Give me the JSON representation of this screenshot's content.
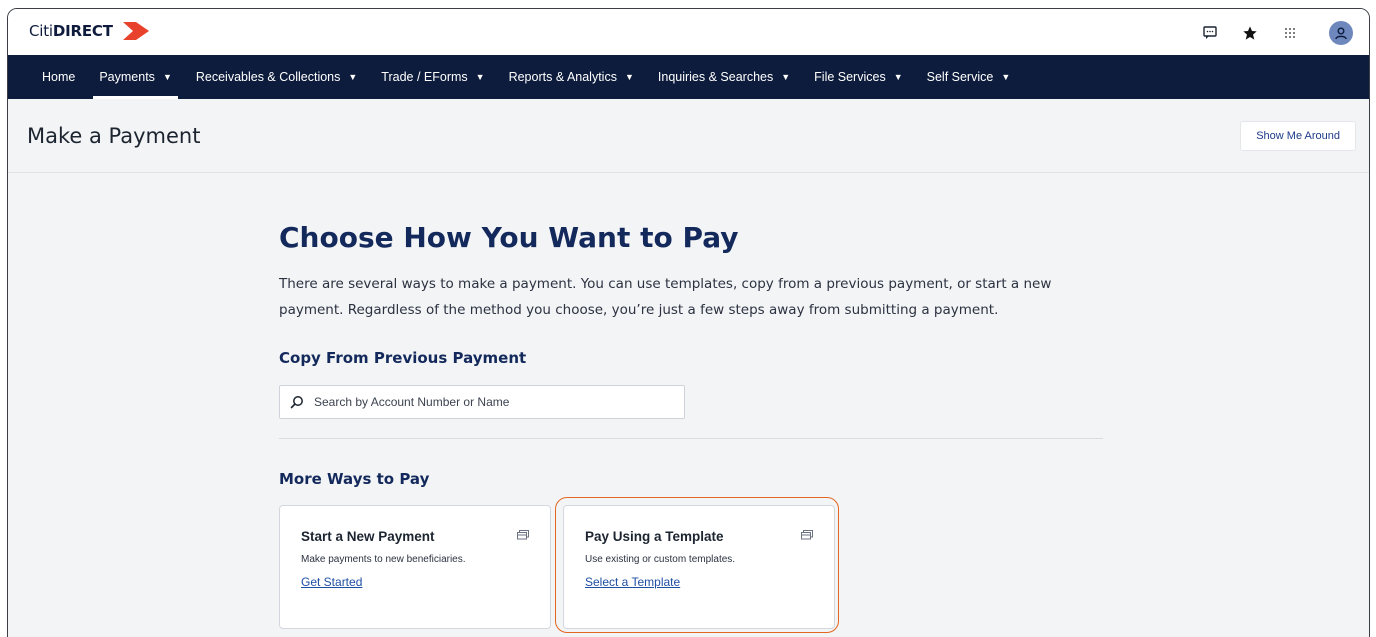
{
  "brand": {
    "citi": "Citi",
    "direct": "DIRECT",
    "arrow_color": "#e8412c"
  },
  "top_icons": [
    "chat-icon",
    "star-icon",
    "apps-grid-icon",
    "user-avatar-icon"
  ],
  "nav": {
    "items": [
      {
        "label": "Home",
        "dropdown": false,
        "active": false
      },
      {
        "label": "Payments",
        "dropdown": true,
        "active": true
      },
      {
        "label": "Receivables & Collections",
        "dropdown": true,
        "active": false
      },
      {
        "label": "Trade / EForms",
        "dropdown": true,
        "active": false
      },
      {
        "label": "Reports & Analytics",
        "dropdown": true,
        "active": false
      },
      {
        "label": "Inquiries & Searches",
        "dropdown": true,
        "active": false
      },
      {
        "label": "File Services",
        "dropdown": true,
        "active": false
      },
      {
        "label": "Self Service",
        "dropdown": true,
        "active": false
      }
    ],
    "caret": "▼"
  },
  "page": {
    "title": "Make a Payment",
    "show_me_around": "Show Me Around"
  },
  "main": {
    "heading": "Choose How You Want to Pay",
    "description": "There are several ways to make a payment. You can use templates, copy from a previous payment, or start a new payment. Regardless of the method you choose, you’re just a few steps away from submitting a payment.",
    "copy_heading": "Copy From Previous Payment",
    "search_placeholder": "Search by Account Number or Name",
    "more_heading": "More Ways to Pay",
    "cards": [
      {
        "title": "Start a New Payment",
        "text": "Make payments to new beneficiaries.",
        "link": "Get Started",
        "icon": "payment-card-icon"
      },
      {
        "title": "Pay Using a Template",
        "text": "Use existing or custom templates.",
        "link": "Select a Template",
        "icon": "payment-card-icon",
        "highlighted": true
      }
    ]
  },
  "colors": {
    "nav_bg": "#0d1c3c",
    "heading": "#13295c",
    "link": "#1f4fa3",
    "highlight": "#e2661f",
    "page_bg": "#f3f4f6"
  }
}
